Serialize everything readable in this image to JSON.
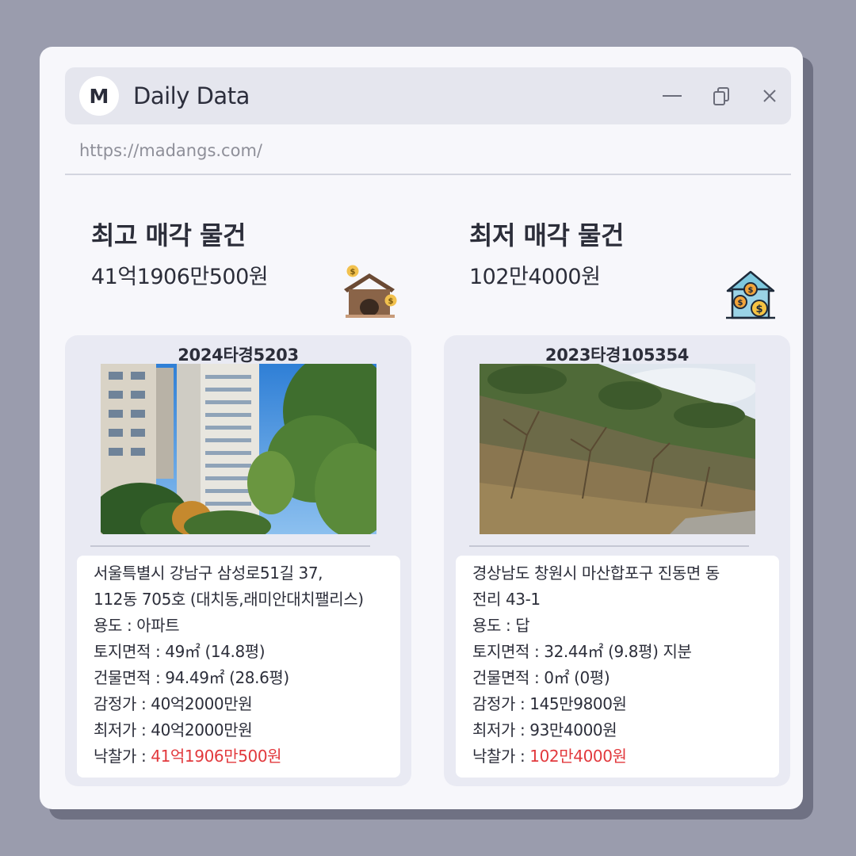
{
  "app": {
    "avatar_letter": "M",
    "title": "Daily Data",
    "url": "https://madangs.com/"
  },
  "highest": {
    "heading": "최고 매각 물건",
    "price": "41억1906만500원",
    "icon": "house-with-coins-icon",
    "case_no": "2024타경5203",
    "photo": "apartment-buildings-photo",
    "address_line1": "서울특별시 강남구 삼성로51길 37,",
    "address_line2": "112동 705호 (대치동,래미안대치팰리스)",
    "usage_label": "용도 : ",
    "usage_value": "아파트",
    "land_label": "토지면적 : ",
    "land_value": "49㎡ (14.8평)",
    "building_label": "건물면적 : ",
    "building_value": "94.49㎡ (28.6평)",
    "appraisal_label": "감정가 : ",
    "appraisal_value": "40억2000만원",
    "minimum_label": "최저가 : ",
    "minimum_value": "40억2000만원",
    "winning_label": "낙찰가 : ",
    "winning_value": "41억1906만500원"
  },
  "lowest": {
    "heading": "최저 매각 물건",
    "price": "102만4000원",
    "icon": "house-dollar-icon",
    "case_no": "2023타경105354",
    "photo": "hillside-land-photo",
    "address_line1": "경상남도 창원시 마산합포구 진동면 동",
    "address_line2": "전리 43-1",
    "usage_label": "용도 :  ",
    "usage_value": "답",
    "land_label": "토지면적 :  ",
    "land_value": "32.44㎡ (9.8평) 지분",
    "building_label": "건물면적 : ",
    "building_value": "0㎡ (0평)",
    "appraisal_label": "감정가 : ",
    "appraisal_value": "145만9800원",
    "minimum_label": "최저가 : ",
    "minimum_value": "93만4000원",
    "winning_label": "낙찰가 : ",
    "winning_value": "102만4000원"
  },
  "colors": {
    "background": "#9a9cad",
    "window": "#f7f7fb",
    "card": "#e9eaf3",
    "highlight": "#e2393d"
  }
}
